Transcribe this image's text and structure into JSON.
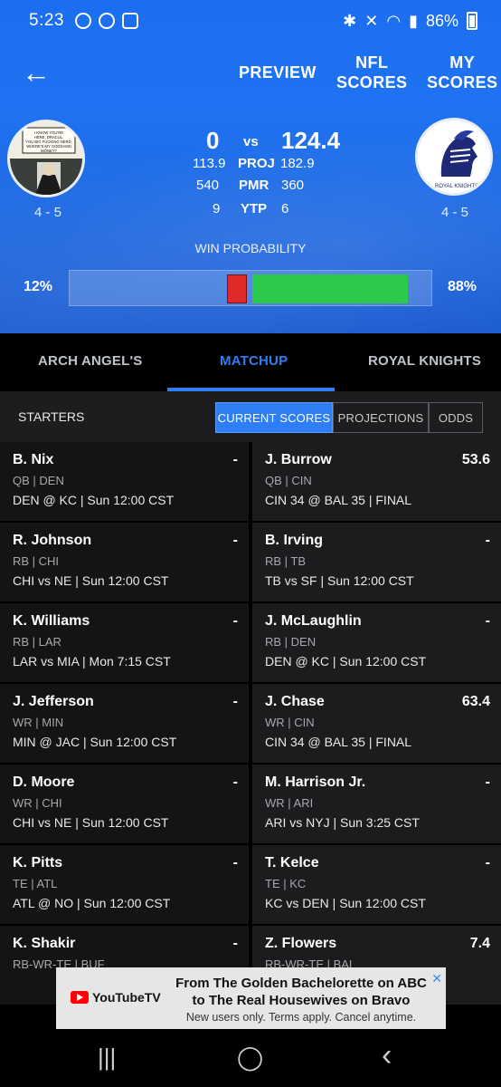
{
  "status_bar": {
    "time": "5:23",
    "battery": "86%"
  },
  "nav": {
    "back_label": "←",
    "preview": "PREVIEW",
    "nfl_scores": "NFL\nSCORES",
    "my_scores": "MY\nSCORES"
  },
  "matchup": {
    "left_team": {
      "record": "4 - 5",
      "score": "0",
      "proj": "113.9",
      "pmr": "540",
      "ytp": "9",
      "win_pct": "12%",
      "win_probability": 0.12
    },
    "right_team": {
      "record": "4 - 5",
      "score": "124.4",
      "proj": "182.9",
      "pmr": "360",
      "ytp": "6",
      "win_pct": "88%",
      "win_probability": 0.88
    },
    "vs": "vs",
    "labels": {
      "proj": "PROJ",
      "pmr": "PMR",
      "ytp": "YTP"
    },
    "win_label": "WIN PROBABILITY",
    "logo_text_right": "ROYAL KNIGHTS",
    "comic_text_left": "I KNOW YOU'RE HERE, DRACUL. YOU BIG FUCKING NERD. WHERE'S MY GODDAMN MONEY?"
  },
  "tabs": {
    "left": "ARCH ANGEL'S",
    "middle": "MATCHUP",
    "right": "ROYAL KNIGHTS"
  },
  "starters": {
    "label": "STARTERS",
    "segments": [
      "CURRENT SCORES",
      "PROJECTIONS",
      "ODDS"
    ]
  },
  "players": [
    {
      "left": {
        "name": "B. Nix",
        "pts": "-",
        "pos": "QB | DEN",
        "game": "DEN @ KC | Sun 12:00 CST"
      },
      "right": {
        "name": "J. Burrow",
        "pts": "53.6",
        "pos": "QB | CIN",
        "game": "CIN 34 @ BAL 35 | FINAL"
      }
    },
    {
      "left": {
        "name": "R. Johnson",
        "pts": "-",
        "pos": "RB | CHI",
        "game": "CHI vs NE | Sun 12:00 CST"
      },
      "right": {
        "name": "B. Irving",
        "pts": "-",
        "pos": "RB | TB",
        "game": "TB vs SF | Sun 12:00 CST"
      }
    },
    {
      "left": {
        "name": "K. Williams",
        "pts": "-",
        "pos": "RB | LAR",
        "game": "LAR vs MIA | Mon 7:15 CST"
      },
      "right": {
        "name": "J. McLaughlin",
        "pts": "-",
        "pos": "RB | DEN",
        "game": "DEN @ KC | Sun 12:00 CST"
      }
    },
    {
      "left": {
        "name": "J. Jefferson",
        "pts": "-",
        "pos": "WR | MIN",
        "game": "MIN @ JAC | Sun 12:00 CST"
      },
      "right": {
        "name": "J. Chase",
        "pts": "63.4",
        "pos": "WR | CIN",
        "game": "CIN 34 @ BAL 35 | FINAL"
      }
    },
    {
      "left": {
        "name": "D. Moore",
        "pts": "-",
        "pos": "WR | CHI",
        "game": "CHI vs NE | Sun 12:00 CST"
      },
      "right": {
        "name": "M. Harrison Jr.",
        "pts": "-",
        "pos": "WR | ARI",
        "game": "ARI vs NYJ | Sun 3:25 CST"
      }
    },
    {
      "left": {
        "name": "K. Pitts",
        "pts": "-",
        "pos": "TE | ATL",
        "game": "ATL @ NO | Sun 12:00 CST"
      },
      "right": {
        "name": "T. Kelce",
        "pts": "-",
        "pos": "TE | KC",
        "game": "KC vs DEN | Sun 12:00 CST"
      }
    },
    {
      "left": {
        "name": "K. Shakir",
        "pts": "-",
        "pos": "RB-WR-TE | BUF",
        "game": ""
      },
      "right": {
        "name": "Z. Flowers",
        "pts": "7.4",
        "pos": "RB-WR-TE | BAL",
        "game": ""
      }
    }
  ],
  "ad": {
    "brand": "YouTubeTV",
    "headline": "From The Golden Bachelorette on ABC to The Real Housewives on Bravo",
    "sub": "New users only. Terms apply. Cancel anytime.",
    "close": "✕"
  },
  "system_nav": {
    "recent": "|||",
    "home": "◯",
    "back": "‹"
  }
}
